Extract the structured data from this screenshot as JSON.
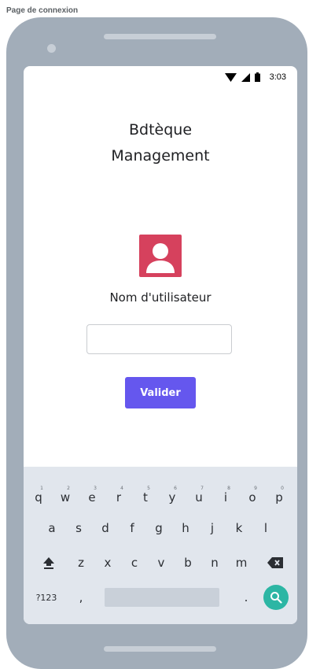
{
  "caption": "Page de connexion",
  "status_bar": {
    "time": "3:03",
    "icons": [
      "wifi-icon",
      "cell-signal-icon",
      "battery-icon"
    ]
  },
  "app": {
    "title_line1": "Bdtèque",
    "title_line2": "Management",
    "avatar_icon": "user-icon",
    "username_label": "Nom d'utilisateur",
    "username_value": "",
    "submit_label": "Valider"
  },
  "keyboard": {
    "row1": [
      {
        "key": "q",
        "hint": "1"
      },
      {
        "key": "w",
        "hint": "2"
      },
      {
        "key": "e",
        "hint": "3"
      },
      {
        "key": "r",
        "hint": "4"
      },
      {
        "key": "t",
        "hint": "5"
      },
      {
        "key": "y",
        "hint": "6"
      },
      {
        "key": "u",
        "hint": "7"
      },
      {
        "key": "i",
        "hint": "8"
      },
      {
        "key": "o",
        "hint": "9"
      },
      {
        "key": "p",
        "hint": "0"
      }
    ],
    "row2": [
      "a",
      "s",
      "d",
      "f",
      "g",
      "h",
      "j",
      "k",
      "l"
    ],
    "row3": [
      "z",
      "x",
      "c",
      "v",
      "b",
      "n",
      "m"
    ],
    "row4": {
      "symbols": "?123",
      "comma": ",",
      "period": "."
    }
  },
  "colors": {
    "phone_frame": "#a2adb9",
    "avatar": "#d6415d",
    "button": "#6557ee",
    "keyboard_bg": "#e1e6ed",
    "search_button": "#2cb6a4"
  }
}
